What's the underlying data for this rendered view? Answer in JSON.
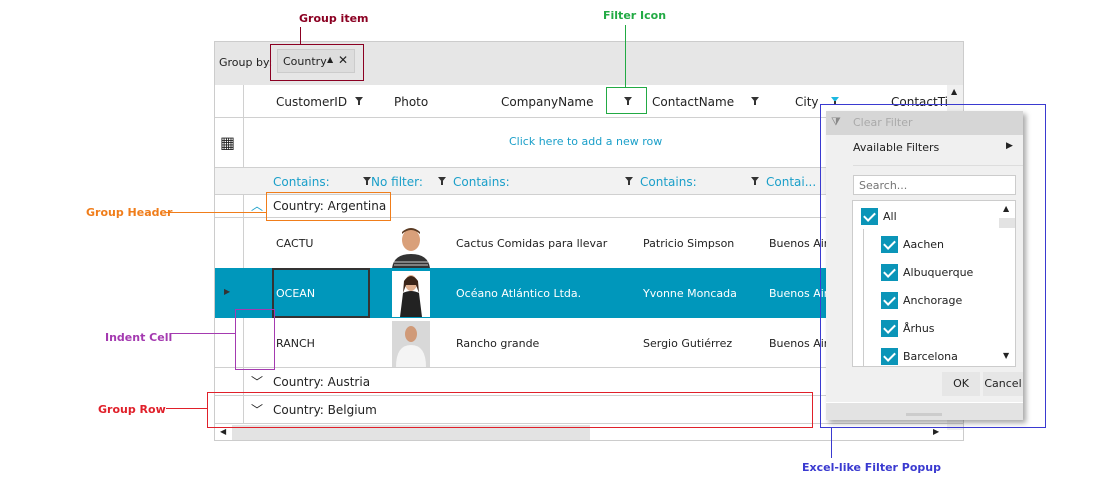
{
  "annotations": {
    "group_item": "Group item",
    "filter_icon": "Filter Icon",
    "group_header": "Group Header",
    "indent_cell": "Indent Cell",
    "group_row": "Group Row",
    "filter_popup": "Excel-like Filter Popup"
  },
  "colors": {
    "accent": "#0097bb",
    "group_item": "#8b0022",
    "filter_icon": "#22aa44",
    "group_header": "#f07d1a",
    "indent_cell": "#a43ab0",
    "group_row": "#e0202a",
    "filter_popup": "#3a3ad0"
  },
  "group_panel": {
    "label": "Group by:",
    "chip": "Country"
  },
  "columns": [
    "CustomerID",
    "Photo",
    "CompanyName",
    "ContactName",
    "City",
    "ContactTitle"
  ],
  "new_row": "Click here to add a new row",
  "filter_row": [
    "Contains:",
    "No filter:",
    "Contains:",
    "Contains:",
    "Contai..."
  ],
  "groups": [
    "Country: Argentina",
    "Country: Austria",
    "Country: Belgium"
  ],
  "rows": [
    {
      "id": "CACTU",
      "company": "Cactus Comidas para llevar",
      "contact": "Patricio Simpson",
      "city": "Buenos Aire"
    },
    {
      "id": "OCEAN",
      "company": "Océano Atlántico Ltda.",
      "contact": "Yvonne Moncada",
      "city": "Buenos Aire"
    },
    {
      "id": "RANCH",
      "company": "Rancho grande",
      "contact": "Sergio Gutiérrez",
      "city": "Buenos Aire"
    }
  ],
  "popup": {
    "clear": "Clear Filter",
    "available": "Available Filters",
    "search_placeholder": "Search...",
    "items": [
      "All",
      "Aachen",
      "Albuquerque",
      "Anchorage",
      "Århus",
      "Barcelona"
    ],
    "ok": "OK",
    "cancel": "Cancel"
  }
}
